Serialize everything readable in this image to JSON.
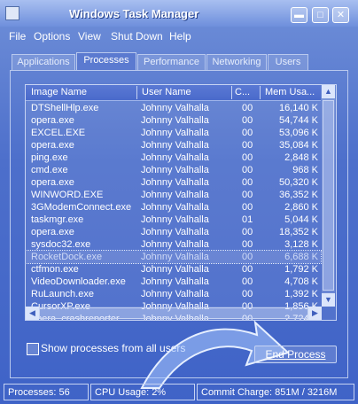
{
  "window": {
    "title": "Windows Task Manager",
    "minimize": "▬",
    "maximize": "□",
    "close": "✕"
  },
  "menu": [
    "File",
    "Options",
    "View",
    "Shut Down",
    "Help"
  ],
  "tabs": [
    "Applications",
    "Processes",
    "Performance",
    "Networking",
    "Users"
  ],
  "active_tab": "Processes",
  "columns": [
    "Image Name",
    "User Name",
    "C...",
    "Mem Usa..."
  ],
  "processes": [
    {
      "name": "DTShellHlp.exe",
      "user": "Johnny Valhalla",
      "cpu": "00",
      "mem": "16,140 K"
    },
    {
      "name": "opera.exe",
      "user": "Johnny Valhalla",
      "cpu": "00",
      "mem": "54,744 K"
    },
    {
      "name": "EXCEL.EXE",
      "user": "Johnny Valhalla",
      "cpu": "00",
      "mem": "53,096 K"
    },
    {
      "name": "opera.exe",
      "user": "Johnny Valhalla",
      "cpu": "00",
      "mem": "35,084 K"
    },
    {
      "name": "ping.exe",
      "user": "Johnny Valhalla",
      "cpu": "00",
      "mem": "2,848 K"
    },
    {
      "name": "cmd.exe",
      "user": "Johnny Valhalla",
      "cpu": "00",
      "mem": "968 K"
    },
    {
      "name": "opera.exe",
      "user": "Johnny Valhalla",
      "cpu": "00",
      "mem": "50,320 K"
    },
    {
      "name": "WINWORD.EXE",
      "user": "Johnny Valhalla",
      "cpu": "00",
      "mem": "36,352 K"
    },
    {
      "name": "3GModemConnect.exe",
      "user": "Johnny Valhalla",
      "cpu": "00",
      "mem": "2,860 K"
    },
    {
      "name": "taskmgr.exe",
      "user": "Johnny Valhalla",
      "cpu": "01",
      "mem": "5,044 K"
    },
    {
      "name": "opera.exe",
      "user": "Johnny Valhalla",
      "cpu": "00",
      "mem": "18,352 K"
    },
    {
      "name": "sysdoc32.exe",
      "user": "Johnny Valhalla",
      "cpu": "00",
      "mem": "3,128 K"
    },
    {
      "name": "RocketDock.exe",
      "user": "Johnny Valhalla",
      "cpu": "00",
      "mem": "6,688 K"
    },
    {
      "name": "ctfmon.exe",
      "user": "Johnny Valhalla",
      "cpu": "00",
      "mem": "1,792 K"
    },
    {
      "name": "VideoDownloader.exe",
      "user": "Johnny Valhalla",
      "cpu": "00",
      "mem": "4,708 K"
    },
    {
      "name": "RuLaunch.exe",
      "user": "Johnny Valhalla",
      "cpu": "00",
      "mem": "1,392 K"
    },
    {
      "name": "CursorXP.exe",
      "user": "Johnny Valhalla",
      "cpu": "00",
      "mem": "1,856 K"
    },
    {
      "name": "opera_crashreporter...",
      "user": "Johnny Valhalla",
      "cpu": "00",
      "mem": "2,724 K"
    }
  ],
  "selected_row": 12,
  "show_all_users_label": "Show processes from all users",
  "show_all_users_checked": false,
  "end_process_label": "End Process",
  "status": {
    "processes": "Processes: 56",
    "cpu": "CPU Usage: 2%",
    "commit": "Commit Charge: 851M / 3216M"
  }
}
